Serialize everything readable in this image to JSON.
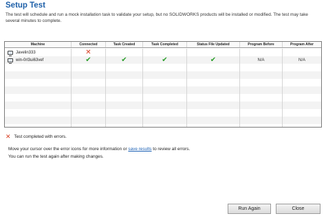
{
  "dialog": {
    "title": "Setup Test",
    "description": "The test will schedule and run a mock installation task to validate your setup, but no SOLIDWORKS products will be installed or modified. The test may take several minutes to complete."
  },
  "table": {
    "columns": [
      "Machine",
      "Connected",
      "Task Created",
      "Task Completed",
      "Status File Updated",
      "Program Before",
      "Program After"
    ],
    "rows": [
      {
        "machine": "Javelin333",
        "connected_icon": "error-x-icon",
        "task_created_icon": "",
        "task_completed_icon": "",
        "status_file_updated_icon": "",
        "program_before": "",
        "program_after": ""
      },
      {
        "machine": "win-0rl3ui63vef",
        "connected_icon": "checkmark-icon",
        "task_created_icon": "checkmark-icon",
        "task_completed_icon": "checkmark-icon",
        "status_file_updated_icon": "checkmark-icon",
        "program_before": "N/A",
        "program_after": "N/A"
      }
    ],
    "empty_row_count": 9
  },
  "status": {
    "icon": "error-x-icon",
    "text": "Test completed with errors."
  },
  "hints": {
    "line1_before": "Move your cursor over the error icons for more information or",
    "link": "save results",
    "line1_after": "to review all errors.",
    "line2": "You can run the test again after making changes."
  },
  "buttons": {
    "run_again": "Run Again",
    "close": "Close"
  },
  "colors": {
    "title": "#1d5fa8",
    "error": "#d73a1d",
    "success": "#2b9e2b",
    "link": "#1a5fb4"
  }
}
